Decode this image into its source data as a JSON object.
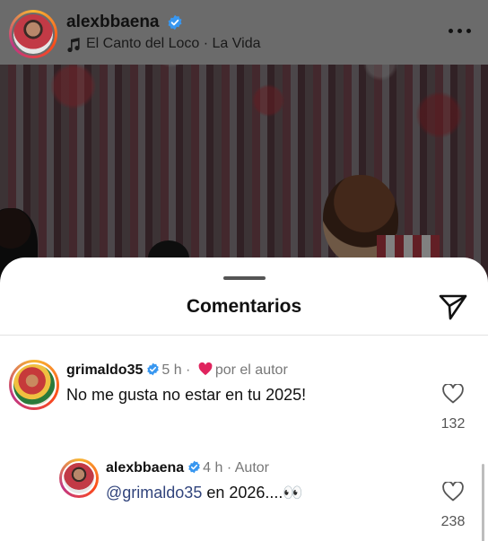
{
  "post_header": {
    "username": "alexbbaena",
    "music": "El Canto del Loco · La Vida"
  },
  "sheet": {
    "title": "Comentarios"
  },
  "comments": [
    {
      "username": "grimaldo35",
      "time": "5 h",
      "liked_by_author_label": "por el autor",
      "text": "No me gusta no estar en tu 2025!",
      "likes": "132"
    },
    {
      "username": "alexbbaena",
      "time": "4 h",
      "author_label": "Autor",
      "mention": "@grimaldo35",
      "text": " en 2026....👀",
      "likes": "238"
    }
  ],
  "colors": {
    "verified": "#3897f0",
    "heart": "#e0245e",
    "mention": "#31447c"
  }
}
